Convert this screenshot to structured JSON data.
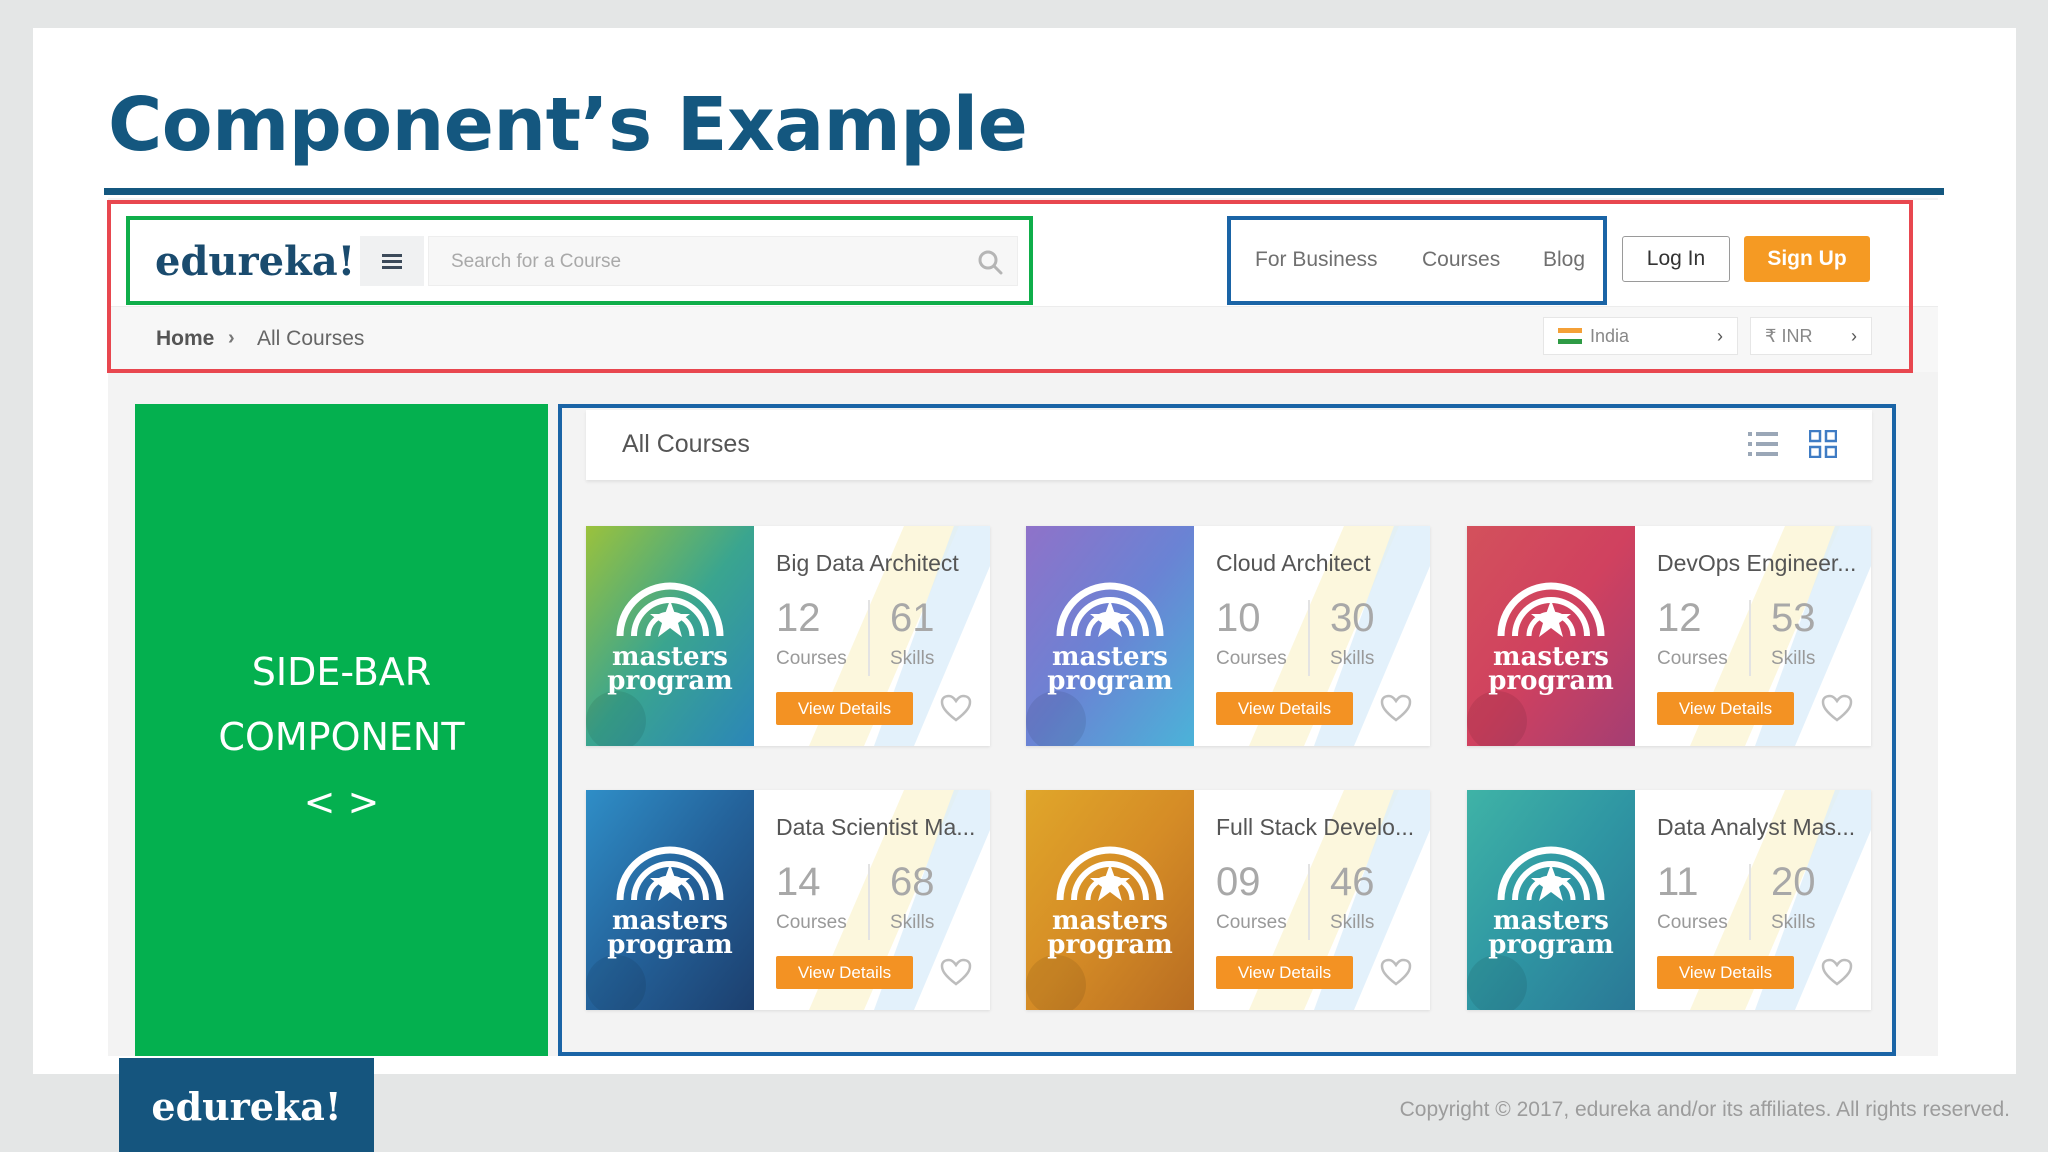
{
  "slide": {
    "title": "Component’s Example",
    "copyright": "Copyright © 2017, edureka and/or its affiliates. All rights reserved.",
    "footer_logo": "edureka!"
  },
  "header": {
    "logo": "edureka!",
    "search_placeholder": "Search for a Course",
    "nav": [
      "For Business",
      "Courses",
      "Blog"
    ],
    "login_label": "Log In",
    "signup_label": "Sign Up"
  },
  "breadcrumb": {
    "home": "Home",
    "separator": "›",
    "current": "All Courses",
    "country": "India",
    "currency": "₹ INR"
  },
  "sidebar": {
    "line1": "SIDE-BAR",
    "line2": "COMPONENT",
    "line3": "< >"
  },
  "courses": {
    "title": "All Courses",
    "badge_line1": "masters",
    "badge_line2": "program",
    "courses_label": "Courses",
    "skills_label": "Skills",
    "button_label": "View Details",
    "items": [
      {
        "name": "Big Data Architect",
        "courses": "12",
        "skills": "61"
      },
      {
        "name": "Cloud Architect",
        "courses": "10",
        "skills": "30"
      },
      {
        "name": "DevOps Engineer...",
        "courses": "12",
        "skills": "53"
      },
      {
        "name": "Data Scientist Ma...",
        "courses": "14",
        "skills": "68"
      },
      {
        "name": "Full Stack Develo...",
        "courses": "09",
        "skills": "46"
      },
      {
        "name": "Data Analyst Mas...",
        "courses": "11",
        "skills": "20"
      }
    ]
  },
  "colors": {
    "title_blue": "#14577f",
    "accent_orange": "#f59a23",
    "sidebar_green": "#04b04f",
    "header_box_red": "#e8474f",
    "logo_box_green": "#0fae4a",
    "nav_box_blue": "#1a64a6"
  }
}
